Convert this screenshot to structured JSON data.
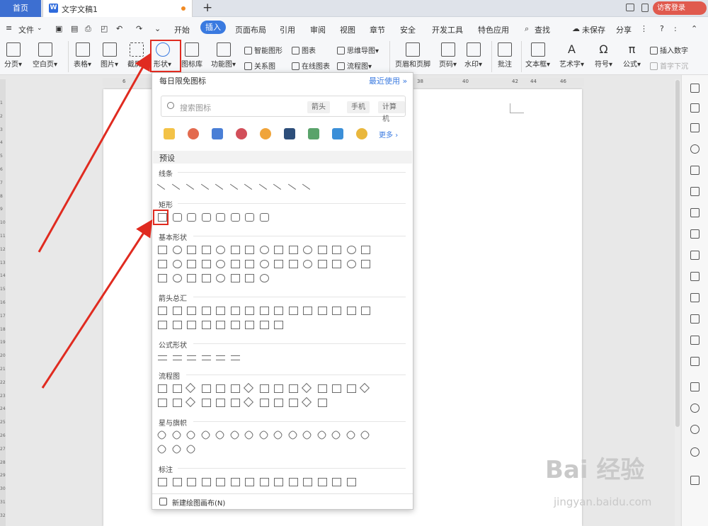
{
  "tabbar": {
    "home": "首页",
    "doc_title": "文字文稿1",
    "new_tab": "+",
    "visitor_login": "访客登录"
  },
  "menu": {
    "file": "文件",
    "items": [
      "开始",
      "插入",
      "页面布局",
      "引用",
      "审阅",
      "视图",
      "章节",
      "安全",
      "开发工具",
      "特色应用"
    ],
    "search": "查找",
    "unsaved": "未保存",
    "share": "分享",
    "help": "?"
  },
  "ribbon": {
    "page_break": "分页",
    "blank_page": "空白页",
    "table": "表格",
    "picture": "图片",
    "screenshot": "截屏",
    "shape": "形状",
    "icon_library": "图标库",
    "function_chart": "功能图",
    "smart_art": "智能图形",
    "chart": "图表",
    "mind_map": "思维导图",
    "relation": "关系图",
    "online_chart": "在线图表",
    "flowchart": "流程图",
    "header_footer": "页眉和页脚",
    "page_number": "页码",
    "watermark": "水印",
    "comment": "批注",
    "textbox": "文本框",
    "wordart": "艺术字",
    "symbol": "符号",
    "formula": "公式",
    "insert_number": "插入数字",
    "drop_cap": "首字下沉"
  },
  "ruler": {
    "left_numbers": [
      "6"
    ],
    "right_numbers": [
      "38",
      "40",
      "42",
      "44",
      "46"
    ],
    "vertical_numbers": [
      "1",
      "2",
      "3",
      "4",
      "5",
      "6",
      "7",
      "8",
      "9",
      "10",
      "11",
      "12",
      "13",
      "14",
      "15",
      "16",
      "17",
      "18",
      "19",
      "20",
      "21",
      "22",
      "23",
      "24",
      "25",
      "26",
      "27",
      "28",
      "29",
      "30",
      "31",
      "32"
    ]
  },
  "panel": {
    "header": "每日限免图标",
    "recent": "最近使用",
    "search_placeholder": "搜索图标",
    "chips": [
      "箭头",
      "手机",
      "计算机"
    ],
    "more": "更多",
    "preset": "预设",
    "sections": {
      "lines": "线条",
      "rectangles": "矩形",
      "basic": "基本形状",
      "arrows": "箭头总汇",
      "equation": "公式形状",
      "flowchart": "流程图",
      "stars": "星与旗帜",
      "callouts": "标注"
    },
    "new_canvas": "新建绘图画布(N)"
  },
  "watermark": {
    "brand": "Bai 经验",
    "url": "jingyan.baidu.com"
  },
  "colors": {
    "accent": "#3a7ae0",
    "home_tab": "#3d6fd1",
    "highlight": "#e02b20",
    "visitor": "#e05a4e"
  }
}
